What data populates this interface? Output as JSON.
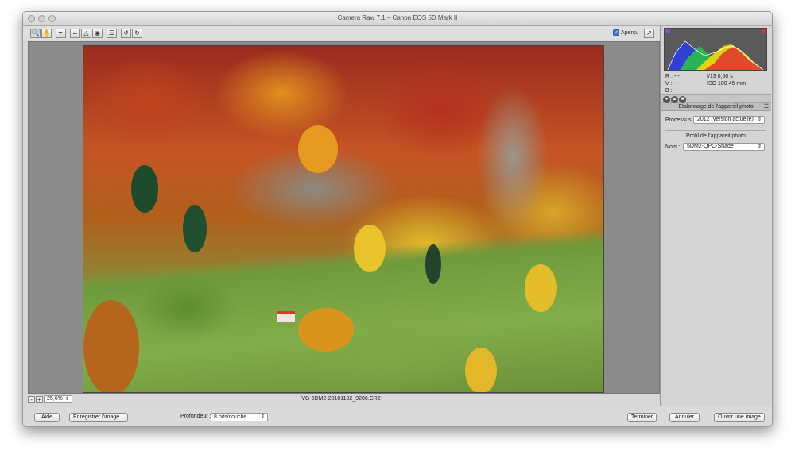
{
  "window": {
    "title": "Camera Raw 7.1  –  Canon EOS 5D Mark II"
  },
  "toolbar": {
    "tools": [
      "zoom-icon",
      "hand-icon",
      "eyedropper-icon",
      "crop-icon",
      "straighten-icon",
      "redeye-icon",
      "list-icon",
      "rotate-left-icon",
      "rotate-right-icon"
    ],
    "preview_label": "Aperçu",
    "preview_checked": true
  },
  "status": {
    "zoom": "25,6%",
    "filename": "VG-5DM2-20101102_9206.CR2"
  },
  "histogram_readout": {
    "r": "R :  ---",
    "v": "V :  ---",
    "b": "B :  ---",
    "aperture_speed": "f/13    0,50 s",
    "iso_focal": "ISO 100    45 mm"
  },
  "panel": {
    "section_title": "Etalonnage de l'appareil photo",
    "process_label": "Processus :",
    "process_value": "2012 (version actuelle)",
    "profile_title": "Profil de l'appareil photo",
    "name_label": "Nom :",
    "name_value": "5DM2-QPC-Shade"
  },
  "footer": {
    "help": "Aide",
    "save": "Enregistrer l'image...",
    "depth_label": "Profondeur :",
    "depth_value": "8 bits/couche",
    "done": "Terminer",
    "cancel": "Annuler",
    "open": "Ouvrir une image"
  }
}
